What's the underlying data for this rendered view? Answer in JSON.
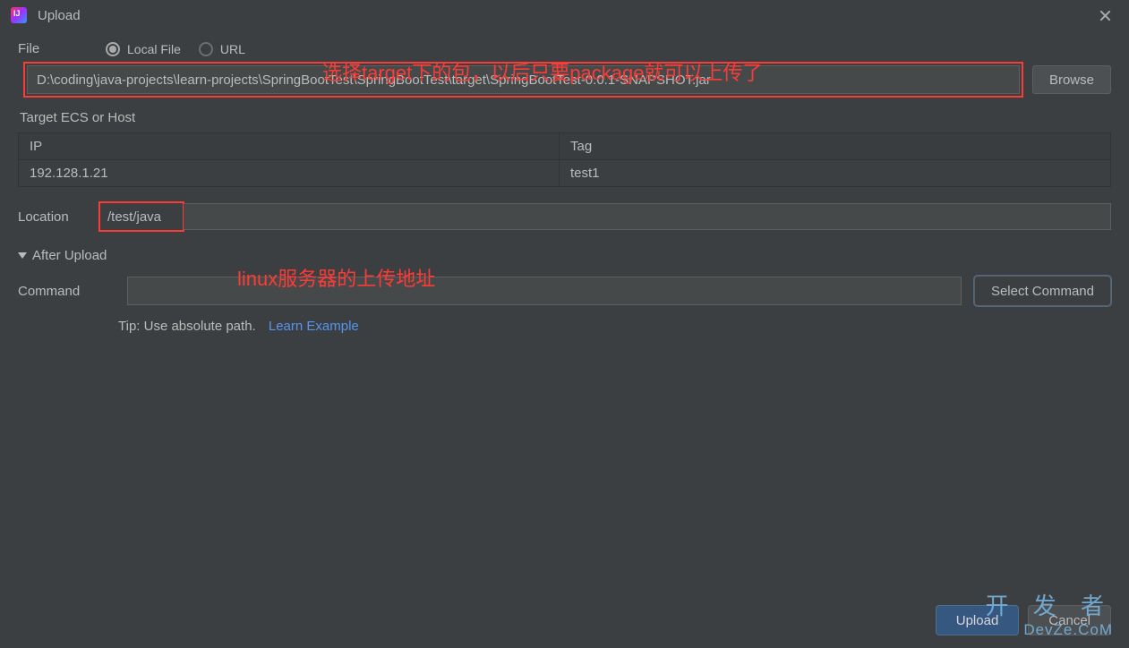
{
  "title": "Upload",
  "file": {
    "label": "File",
    "options": {
      "local": "Local File",
      "url": "URL"
    },
    "selected": "local",
    "path": "D:\\coding\\java-projects\\learn-projects\\SpringBootTest\\SpringBootTest\\target\\SpringBootTest-0.0.1-SNAPSHOT.jar",
    "browse": "Browse"
  },
  "annotations": {
    "a1": "选择target下的包，以后只要package就可以上传了",
    "a2": "linux服务器的上传地址"
  },
  "target": {
    "label": "Target ECS or Host",
    "headers": {
      "ip": "IP",
      "tag": "Tag"
    },
    "rows": [
      {
        "ip": "192.128.1.21",
        "tag": "test1"
      }
    ]
  },
  "location": {
    "label": "Location",
    "value": "/test/java"
  },
  "after": {
    "label": "After Upload",
    "command_label": "Command",
    "command_value": "",
    "select_btn": "Select Command",
    "tip": "Tip: Use absolute path.",
    "learn": "Learn Example"
  },
  "footer": {
    "upload": "Upload",
    "cancel": "Cancel"
  },
  "watermark": {
    "cn": "开 发 者",
    "en": "DevZe.CoM"
  }
}
